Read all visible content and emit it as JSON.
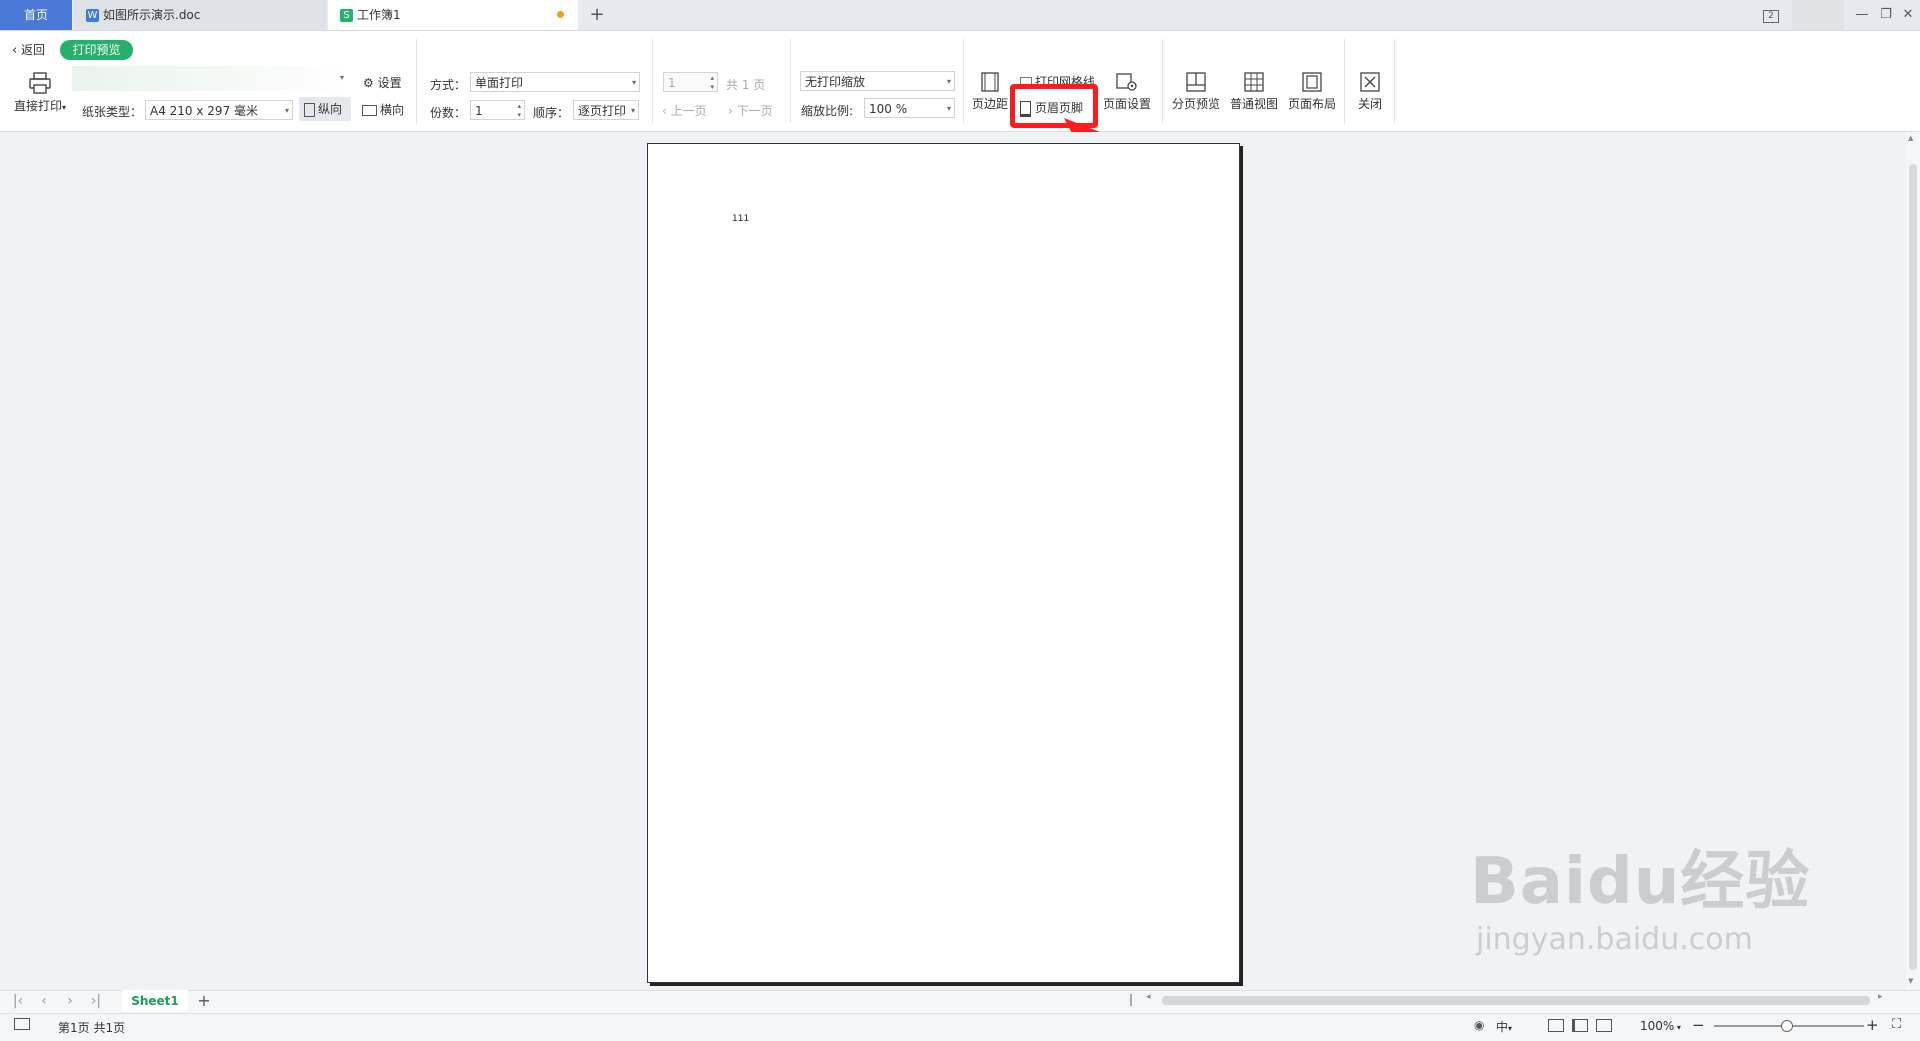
{
  "tabs": {
    "home": "首页",
    "doc": "如图所示演示.doc",
    "sheet": "工作簿1",
    "add": "+",
    "window_badge": "2"
  },
  "toolbar": {
    "back": "返回",
    "mode_badge": "打印预览",
    "direct_print": "直接打印",
    "settings": "设置",
    "paper_type_label": "纸张类型：",
    "paper_type_value": "A4 210 x 297 毫米",
    "portrait": "纵向",
    "landscape": "横向",
    "method_label": "方式：",
    "method_value": "单面打印",
    "copies_label": "份数：",
    "copies_value": "1",
    "order_label": "顺序：",
    "order_value": "逐页打印",
    "page_input": "1",
    "page_total": "共 1 页",
    "prev_page": "上一页",
    "next_page": "下一页",
    "scale_mode": "无打印缩放",
    "scale_label": "缩放比例:",
    "scale_value": "100 %",
    "margins": "页边距",
    "print_gridlines": "打印网格线",
    "header_footer": "页眉页脚",
    "page_setup": "页面设置",
    "page_break_preview": "分页预览",
    "normal_view": "普通视图",
    "page_layout": "页面布局",
    "close": "关闭"
  },
  "page": {
    "cell_text": "111"
  },
  "sheetbar": {
    "sheet_name": "Sheet1",
    "add": "+"
  },
  "status": {
    "page_info": "第1页 共1页",
    "zoom": "100%",
    "lang": "中"
  },
  "watermark": {
    "brand": "Baidu经验",
    "url": "jingyan.baidu.com"
  },
  "colors": {
    "accent_green": "#25b06b",
    "highlight_red": "#ff1b1b",
    "tab_blue": "#4a78d6"
  }
}
